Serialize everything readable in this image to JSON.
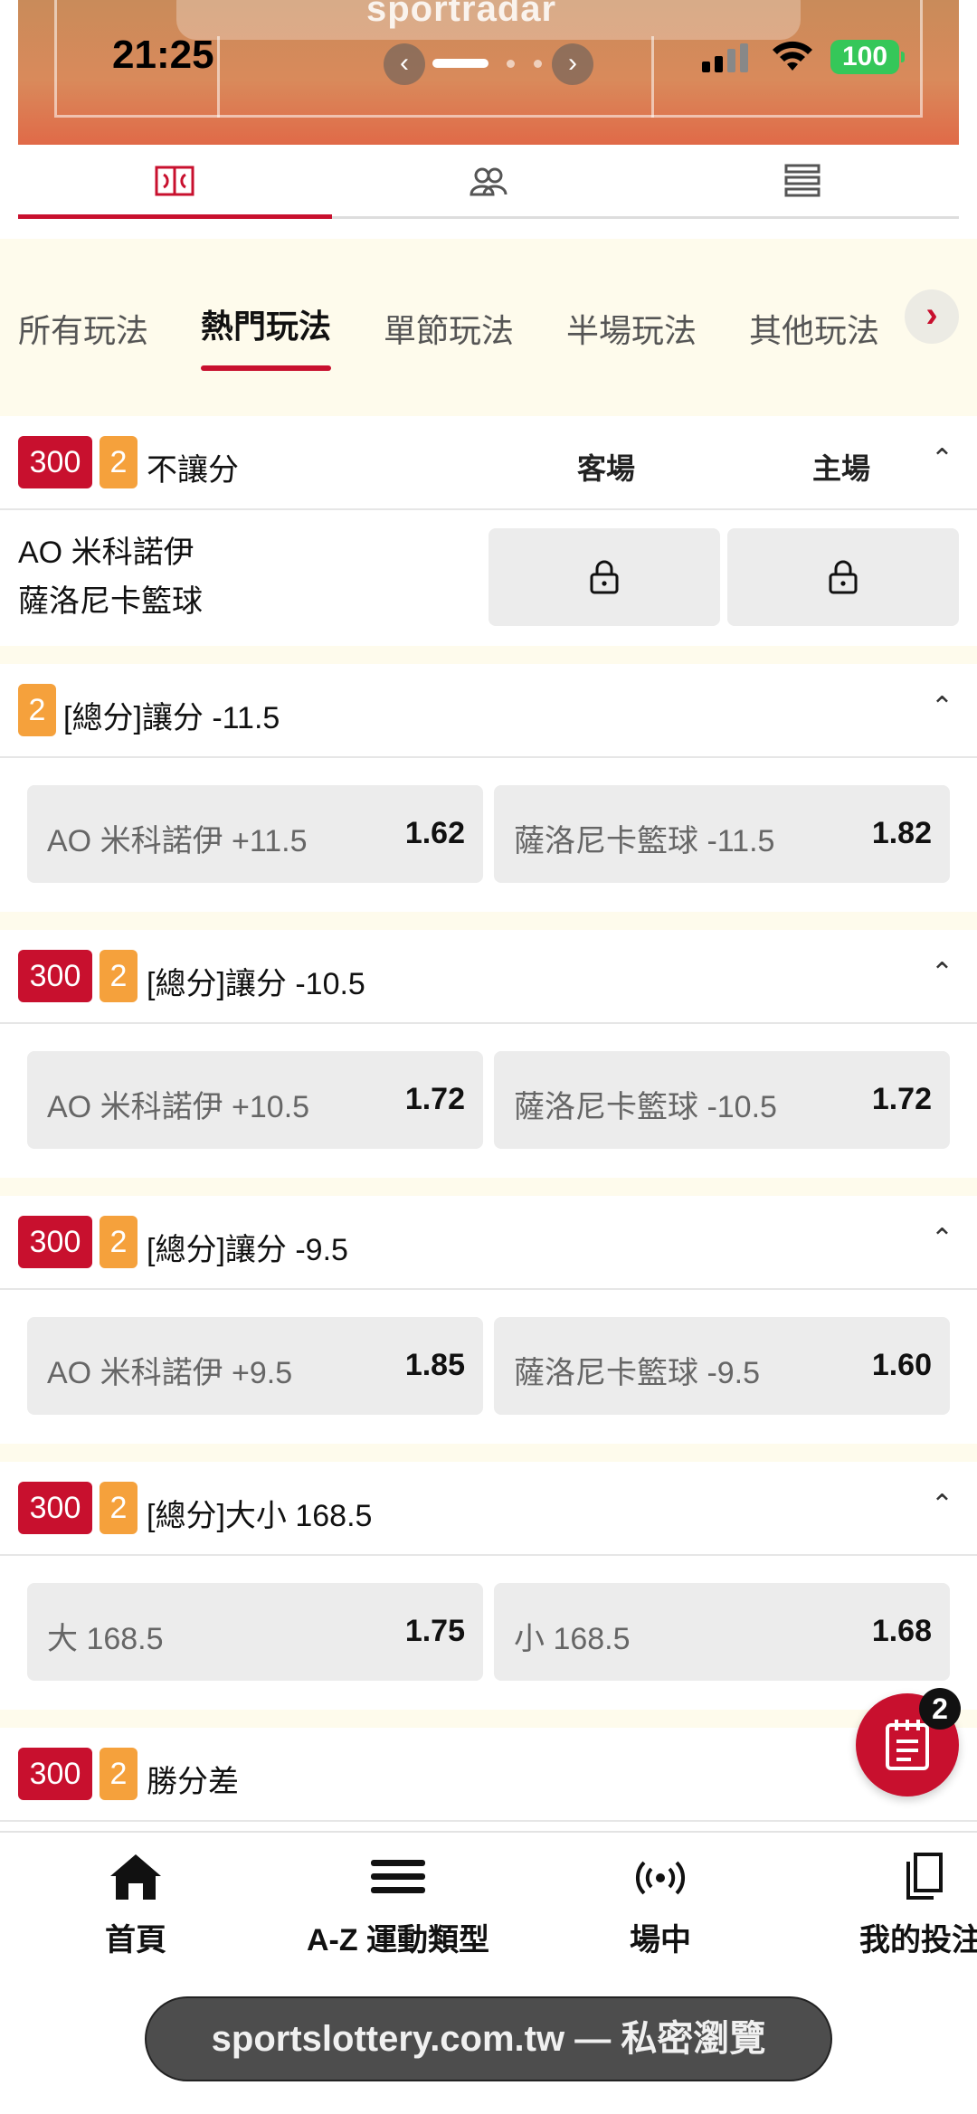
{
  "status_bar": {
    "time": "21:25",
    "battery": "100",
    "brand": "sportradar"
  },
  "view_tabs": [
    {
      "name": "court-icon"
    },
    {
      "name": "players-icon"
    },
    {
      "name": "stats-list-icon"
    }
  ],
  "categories": [
    "所有玩法",
    "熱門玩法",
    "單節玩法",
    "半場玩法",
    "其他玩法"
  ],
  "active_category": "熱門玩法",
  "markets": [
    {
      "badge_id": "300",
      "badge_num": "2",
      "title": "不讓分",
      "col_away": "客場",
      "col_home": "主場",
      "team_away": "AO 米科諾伊",
      "team_home": "薩洛尼卡籃球",
      "locked": true
    },
    {
      "badge_num": "2",
      "title": "[總分]讓分 -11.5",
      "odds": [
        {
          "label": "AO 米科諾伊 +11.5",
          "value": "1.62"
        },
        {
          "label": "薩洛尼卡籃球 -11.5",
          "value": "1.82"
        }
      ]
    },
    {
      "badge_id": "300",
      "badge_num": "2",
      "title": "[總分]讓分 -10.5",
      "odds": [
        {
          "label": "AO 米科諾伊 +10.5",
          "value": "1.72"
        },
        {
          "label": "薩洛尼卡籃球 -10.5",
          "value": "1.72"
        }
      ]
    },
    {
      "badge_id": "300",
      "badge_num": "2",
      "title": "[總分]讓分 -9.5",
      "odds": [
        {
          "label": "AO 米科諾伊 +9.5",
          "value": "1.85"
        },
        {
          "label": "薩洛尼卡籃球 -9.5",
          "value": "1.60"
        }
      ]
    },
    {
      "badge_id": "300",
      "badge_num": "2",
      "title": "[總分]大小 168.5",
      "odds": [
        {
          "label": "大 168.5",
          "value": "1.75"
        },
        {
          "label": "小 168.5",
          "value": "1.68"
        }
      ]
    },
    {
      "badge_id": "300",
      "badge_num": "2",
      "title": "勝分差"
    }
  ],
  "betslip_count": "2",
  "bottom_nav": [
    {
      "label": "首頁",
      "icon": "home-icon"
    },
    {
      "label": "A-Z 運動類型",
      "icon": "menu-icon"
    },
    {
      "label": "場中",
      "icon": "live-icon"
    },
    {
      "label": "我的投注",
      "icon": "my-bets-icon"
    }
  ],
  "url_bar": "sportslottery.com.tw — 私密瀏覽",
  "colors": {
    "accent": "#c8102e",
    "badge_orange": "#f5a13c",
    "cream": "#fefbec"
  }
}
